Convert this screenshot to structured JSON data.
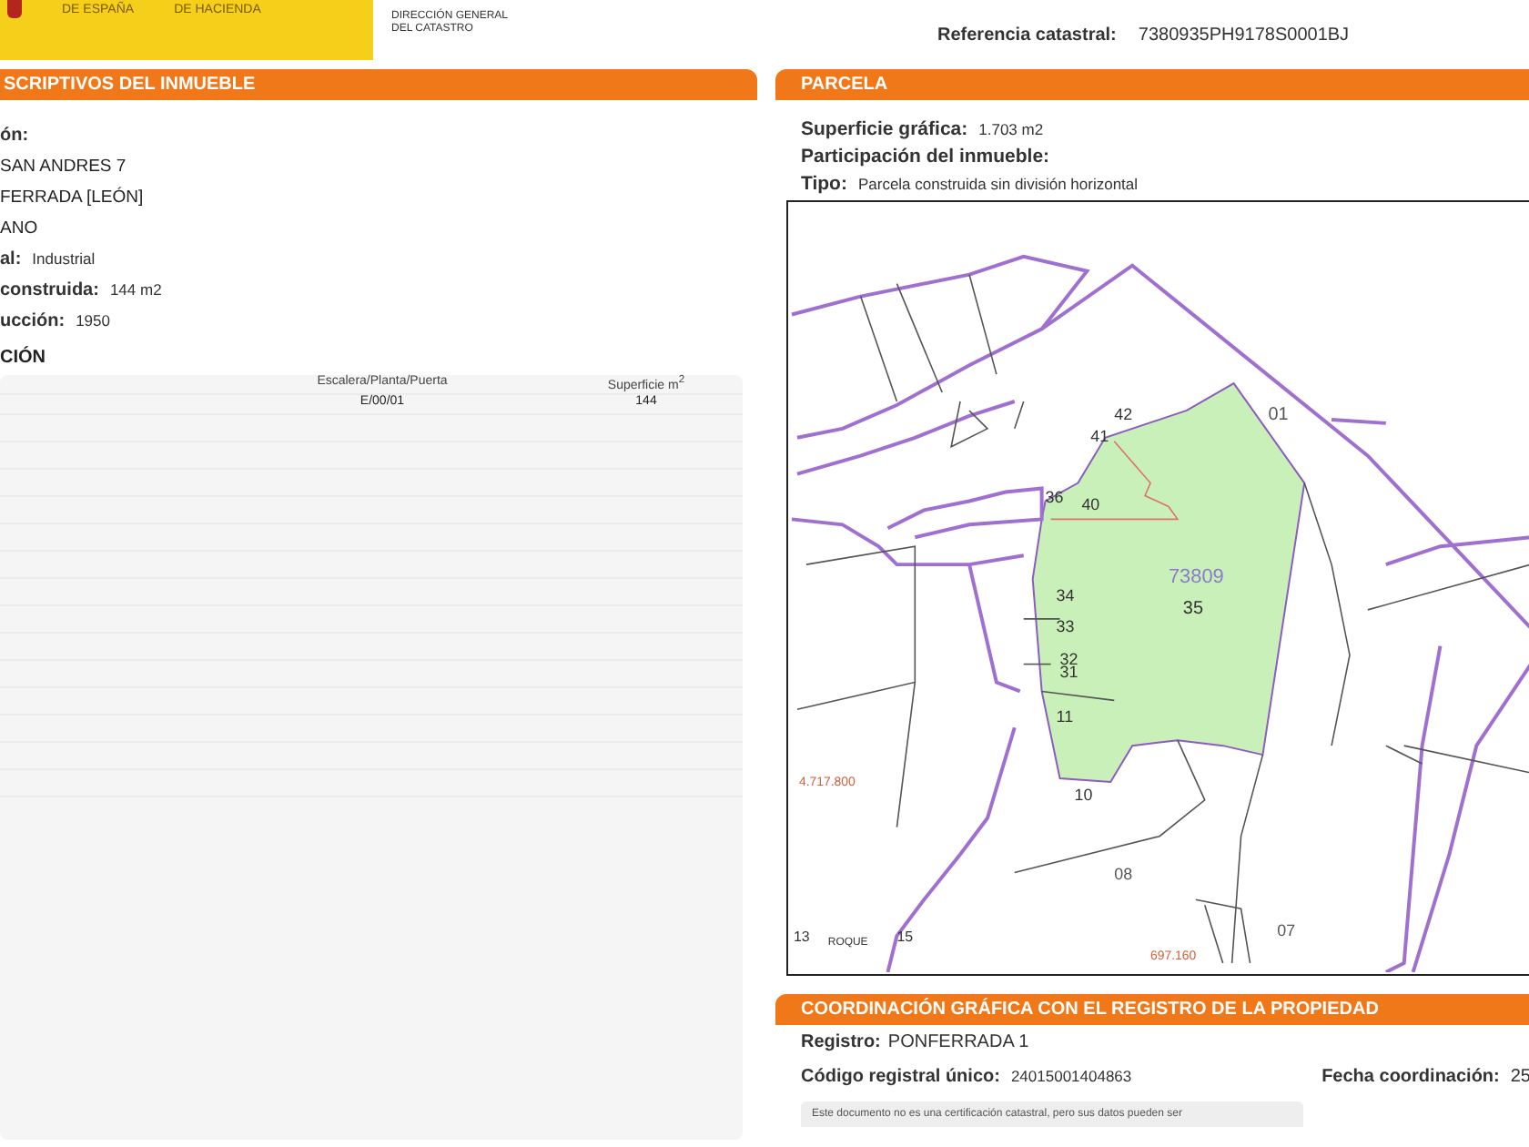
{
  "header": {
    "ministry_lines": [
      "DE ESPAÑA",
      "DE HACIENDA"
    ],
    "agency_lines": [
      "DIRECCIÓN GENERAL",
      "DEL CATASTRO"
    ],
    "reference_label": "Referencia catastral:",
    "reference_value": "7380935PH9178S0001BJ"
  },
  "property": {
    "title": "SCRIPTIVOS DEL INMUEBLE",
    "fields": [
      {
        "label": "ón:"
      },
      {
        "value": "SAN ANDRES 7"
      },
      {
        "value": "FERRADA [LEÓN]"
      },
      {
        "value": "ANO"
      },
      {
        "label": "al:",
        "value": "Industrial"
      },
      {
        "label": "construida:",
        "value": "144 m2"
      },
      {
        "label": "ucción:",
        "value": "1950"
      }
    ],
    "section": "CIÓN",
    "table": {
      "columns": [
        "Escalera/Planta/Puerta",
        "Superficie m$^{2}$"
      ],
      "rows": [
        [
          "E/00/01",
          "144"
        ]
      ]
    }
  },
  "parcel": {
    "title": "PARCELA",
    "fields": [
      {
        "label": "Superficie gráfica:",
        "value": "1.703 m2"
      },
      {
        "label": "Participación del inmueble:"
      },
      {
        "label": "Tipo:",
        "value": "Parcela construida sin división horizontal"
      }
    ],
    "map_labels": [
      "42",
      "01",
      "41",
      "36",
      "40",
      "73809",
      "34",
      "35",
      "33",
      "32",
      "31",
      "11",
      "4.717.800",
      "10",
      "08",
      "07",
      "13",
      "ROQUE",
      "15",
      "697.160"
    ]
  },
  "registry": {
    "title": "COORDINACIÓN GRÁFICA CON EL REGISTRO DE LA PROPIEDAD",
    "registro_label": "Registro:",
    "registro_value": "PONFERRADA 1",
    "code_label": "Código registral único:",
    "code_value": "24015001404863",
    "date_label": "Fecha coordinación:",
    "date_value": "25",
    "notice": "Este documento no es una certificación catastral, pero sus datos pueden ser"
  }
}
